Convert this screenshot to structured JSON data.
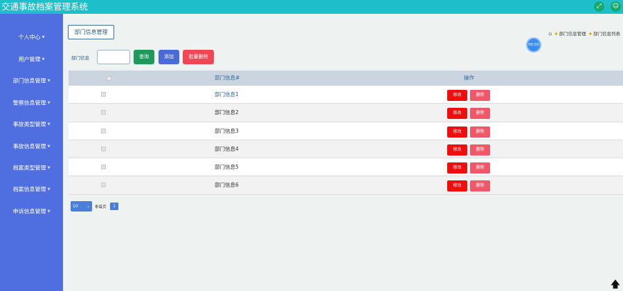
{
  "app": {
    "title": "交通事故档案管理系统",
    "icons": [
      "fullscreen-icon",
      "user-icon"
    ]
  },
  "sidebar": {
    "items": [
      {
        "label": "个人中心"
      },
      {
        "label": "用户管理"
      },
      {
        "label": "部门信息管理"
      },
      {
        "label": "警察信息管理"
      },
      {
        "label": "事故类型管理"
      },
      {
        "label": "事故信息管理"
      },
      {
        "label": "档案类型管理"
      },
      {
        "label": "档案信息管理"
      },
      {
        "label": "申诉信息管理"
      }
    ]
  },
  "page": {
    "title": "部门信息管理",
    "breadcrumb": [
      "部门信息管理",
      "部门信息列表"
    ],
    "timer": "00:50"
  },
  "search": {
    "label": "部门信息",
    "value": "",
    "search_label": "查询",
    "add_label": "添加",
    "batch_delete_label": "批量删除"
  },
  "table": {
    "headers": {
      "name": "部门信息#",
      "action": "操作"
    },
    "rows": [
      {
        "name": "部门信息1",
        "edit": "修改",
        "delete": "删除"
      },
      {
        "name": "部门信息2",
        "edit": "修改",
        "delete": "删除"
      },
      {
        "name": "部门信息3",
        "edit": "修改",
        "delete": "删除"
      },
      {
        "name": "部门信息4",
        "edit": "修改",
        "delete": "删除"
      },
      {
        "name": "部门信息5",
        "edit": "修改",
        "delete": "删除"
      },
      {
        "name": "部门信息6",
        "edit": "修改",
        "delete": "删除"
      }
    ]
  },
  "pager": {
    "page_size": "10",
    "per_page_label": "条每页",
    "current_page": "1"
  },
  "colors": {
    "topbar": "#1ebecb",
    "sidebar": "#4f6ee0",
    "search_button": "#1f9a5c",
    "add_button": "#4a6ad8",
    "batch_delete_button": "#f14655",
    "edit_button": "#ef0e0e",
    "delete_button": "#f05869"
  }
}
